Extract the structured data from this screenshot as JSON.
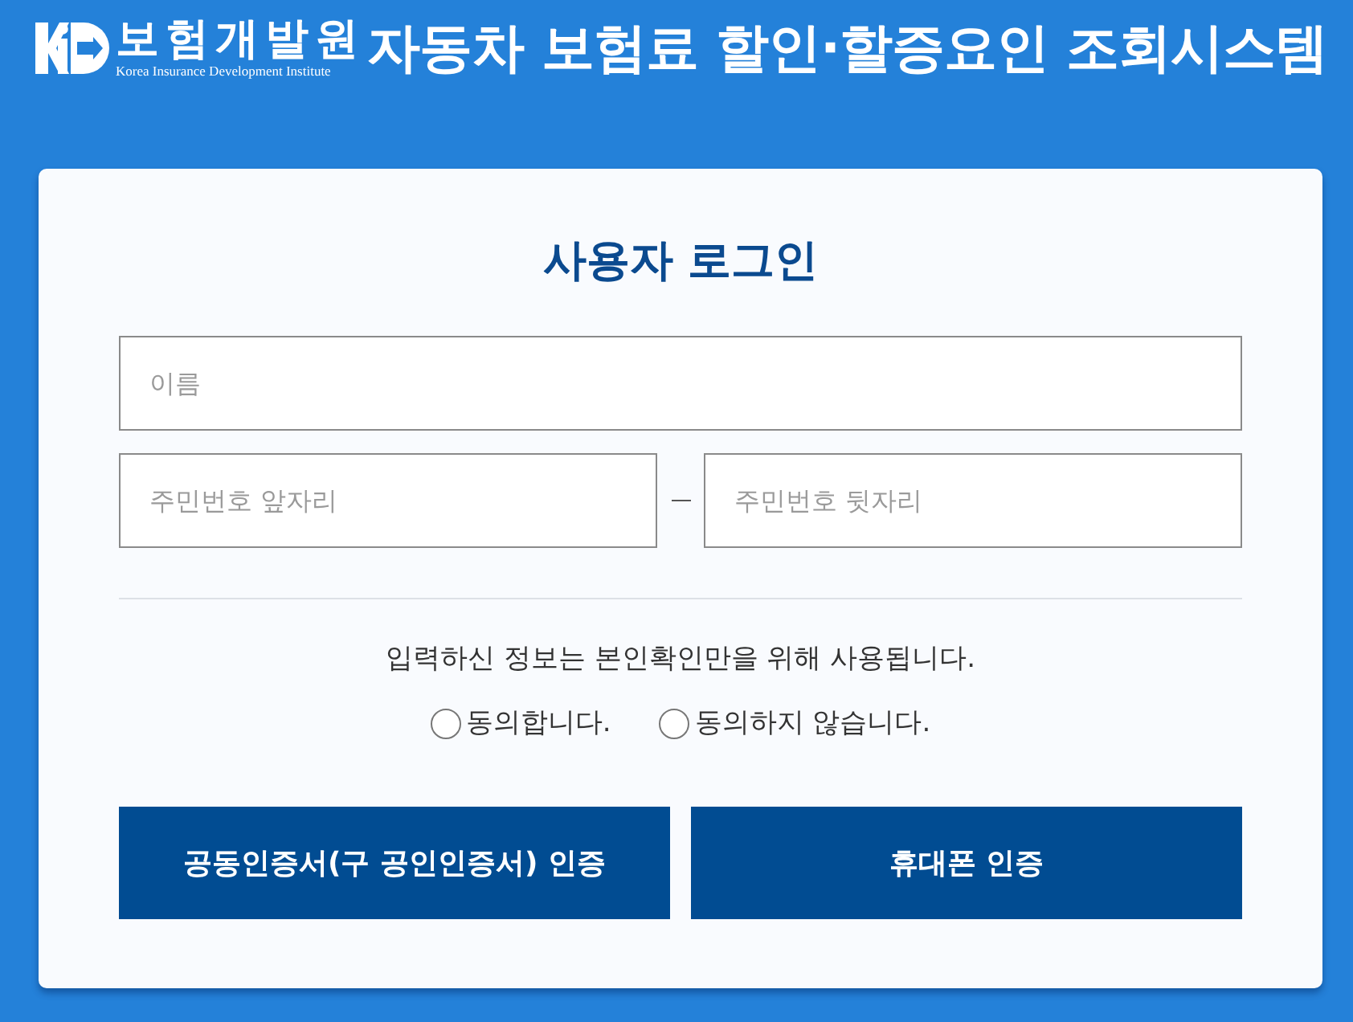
{
  "header": {
    "logo": {
      "name": "보험개발원",
      "subtitle": "Korea Insurance Development Institute"
    },
    "title": "자동차 보험료 할인·할증요인 조회시스템"
  },
  "login": {
    "heading": "사용자 로그인",
    "name_field": {
      "placeholder": "이름"
    },
    "id_fields": [
      {
        "placeholder": "주민번호 앞자리"
      },
      {
        "placeholder": "주민번호 뒷자리"
      }
    ],
    "notice": "입력하신 정보는 본인확인만을 위해 사용됩니다.",
    "consent_options": [
      {
        "label": "동의합니다.",
        "selected": false
      },
      {
        "label": "동의하지 않습니다.",
        "selected": false
      }
    ],
    "buttons": [
      {
        "label": "공동인증서(구 공인인증서) 인증"
      },
      {
        "label": "휴대폰 인증"
      }
    ]
  }
}
